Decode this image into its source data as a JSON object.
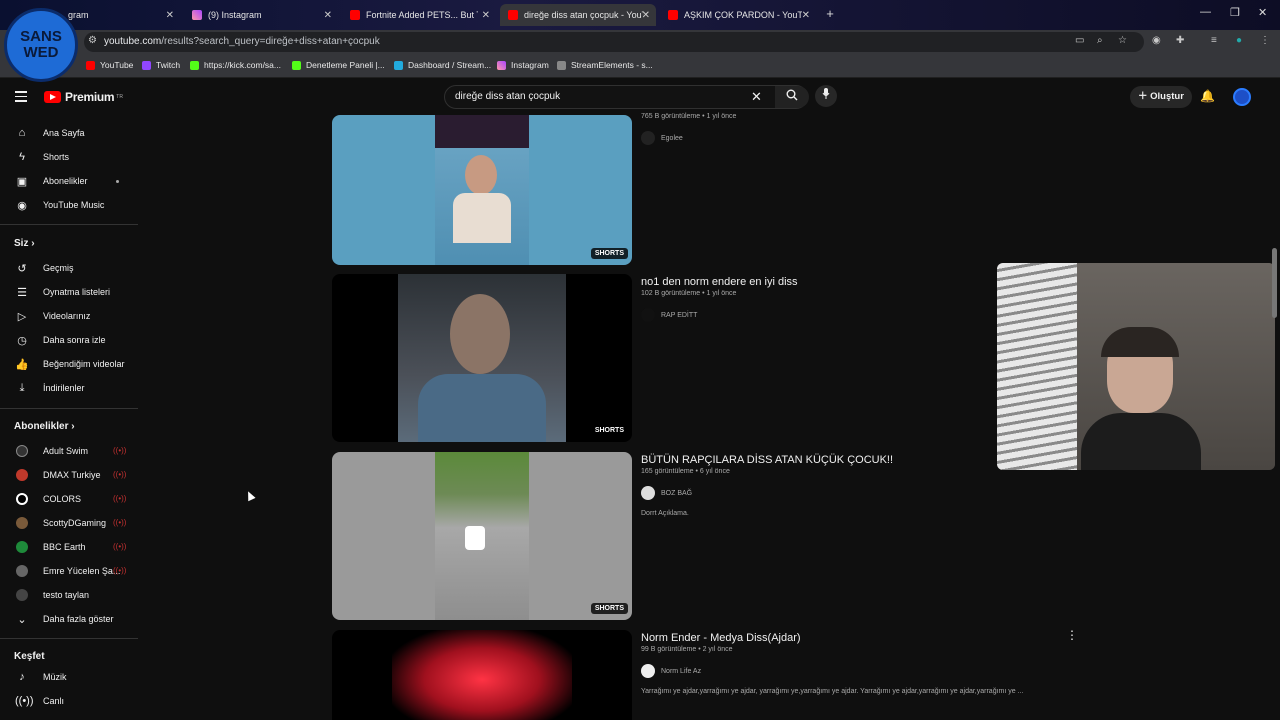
{
  "browser": {
    "tabs": [
      {
        "label": "gram",
        "active": false
      },
      {
        "label": "(9) Instagram",
        "active": false
      },
      {
        "label": "Fortnite Added PETS... But The",
        "active": false
      },
      {
        "label": "direğe diss atan çocpuk - YouTu",
        "active": true
      },
      {
        "label": "AŞKIM ÇOK PARDON - YouTub",
        "active": false
      }
    ],
    "url_host": "youtube.com",
    "url_path": "/results?search_query=direğe+diss+atan+çocpuk",
    "bookmarks": [
      "YouTube",
      "Twitch",
      "https://kick.com/sa...",
      "Denetleme Paneli |...",
      "Dashboard / Stream...",
      "Instagram",
      "StreamElements - s..."
    ]
  },
  "overlay_logo": {
    "line1": "SANS",
    "line2": "WED"
  },
  "header": {
    "brand": "Premium",
    "brand_region": "TR",
    "search_value": "direğe diss atan çocpuk",
    "create_label": "Oluştur"
  },
  "sidebar": {
    "main": [
      {
        "label": "Ana Sayfa",
        "icon": "home-icon"
      },
      {
        "label": "Shorts",
        "icon": "shorts-icon"
      },
      {
        "label": "Abonelikler",
        "icon": "subscriptions-icon"
      },
      {
        "label": "YouTube Music",
        "icon": "music-icon"
      }
    ],
    "you_heading": "Siz",
    "you": [
      {
        "label": "Geçmiş",
        "icon": "history-icon"
      },
      {
        "label": "Oynatma listeleri",
        "icon": "playlist-icon"
      },
      {
        "label": "Videolarınız",
        "icon": "your-videos-icon"
      },
      {
        "label": "Daha sonra izle",
        "icon": "watch-later-icon"
      },
      {
        "label": "Beğendiğim videolar",
        "icon": "like-icon"
      },
      {
        "label": "İndirilenler",
        "icon": "download-icon"
      }
    ],
    "subs_heading": "Abonelikler",
    "subs": [
      {
        "label": "Adult Swim",
        "color": "#333333"
      },
      {
        "label": "DMAX Turkiye",
        "color": "#c0392b"
      },
      {
        "label": "COLORS",
        "color": "#ffffff"
      },
      {
        "label": "ScottyDGaming",
        "color": "#7a5a3a"
      },
      {
        "label": "BBC Earth",
        "color": "#1e8a3a"
      },
      {
        "label": "Emre Yücelen Şa...",
        "color": "#666666"
      },
      {
        "label": "testo taylan",
        "color": "#444444"
      }
    ],
    "more_label": "Daha fazla göster",
    "explore_heading": "Keşfet",
    "explore": [
      {
        "label": "Müzik",
        "icon": "music-note-icon"
      },
      {
        "label": "Canlı",
        "icon": "live-icon"
      }
    ]
  },
  "results": [
    {
      "title": "",
      "meta": "765 B görüntüleme • 1 yıl önce",
      "channel": "Egolee",
      "desc": "",
      "badge": "SHORTS"
    },
    {
      "title": "no1 den norm endere en iyi diss",
      "meta": "102 B görüntüleme • 1 yıl önce",
      "channel": "RAP EDİTT",
      "desc": "",
      "badge": "SHORTS"
    },
    {
      "title": "BÜTÜN RAPÇILARA DİSS ATAN KÜÇÜK ÇOCUK!!",
      "meta": "165 görüntüleme • 6 yıl önce",
      "channel": "BOZ BAĞ",
      "desc": "Dorrt Açıklama.",
      "badge": "SHORTS"
    },
    {
      "title": "Norm Ender - Medya Diss(Ajdar)",
      "meta": "99 B görüntüleme • 2 yıl önce",
      "channel": "Norm Life Az",
      "desc": "Yarrağımı ye ajdar,yarrağımı ye ajdar, yarrağımı ye,yarrağımı ye ajdar. Yarrağımı ye ajdar,yarrağımı ye ajdar,yarrağımı ye ...",
      "badge": ""
    }
  ]
}
